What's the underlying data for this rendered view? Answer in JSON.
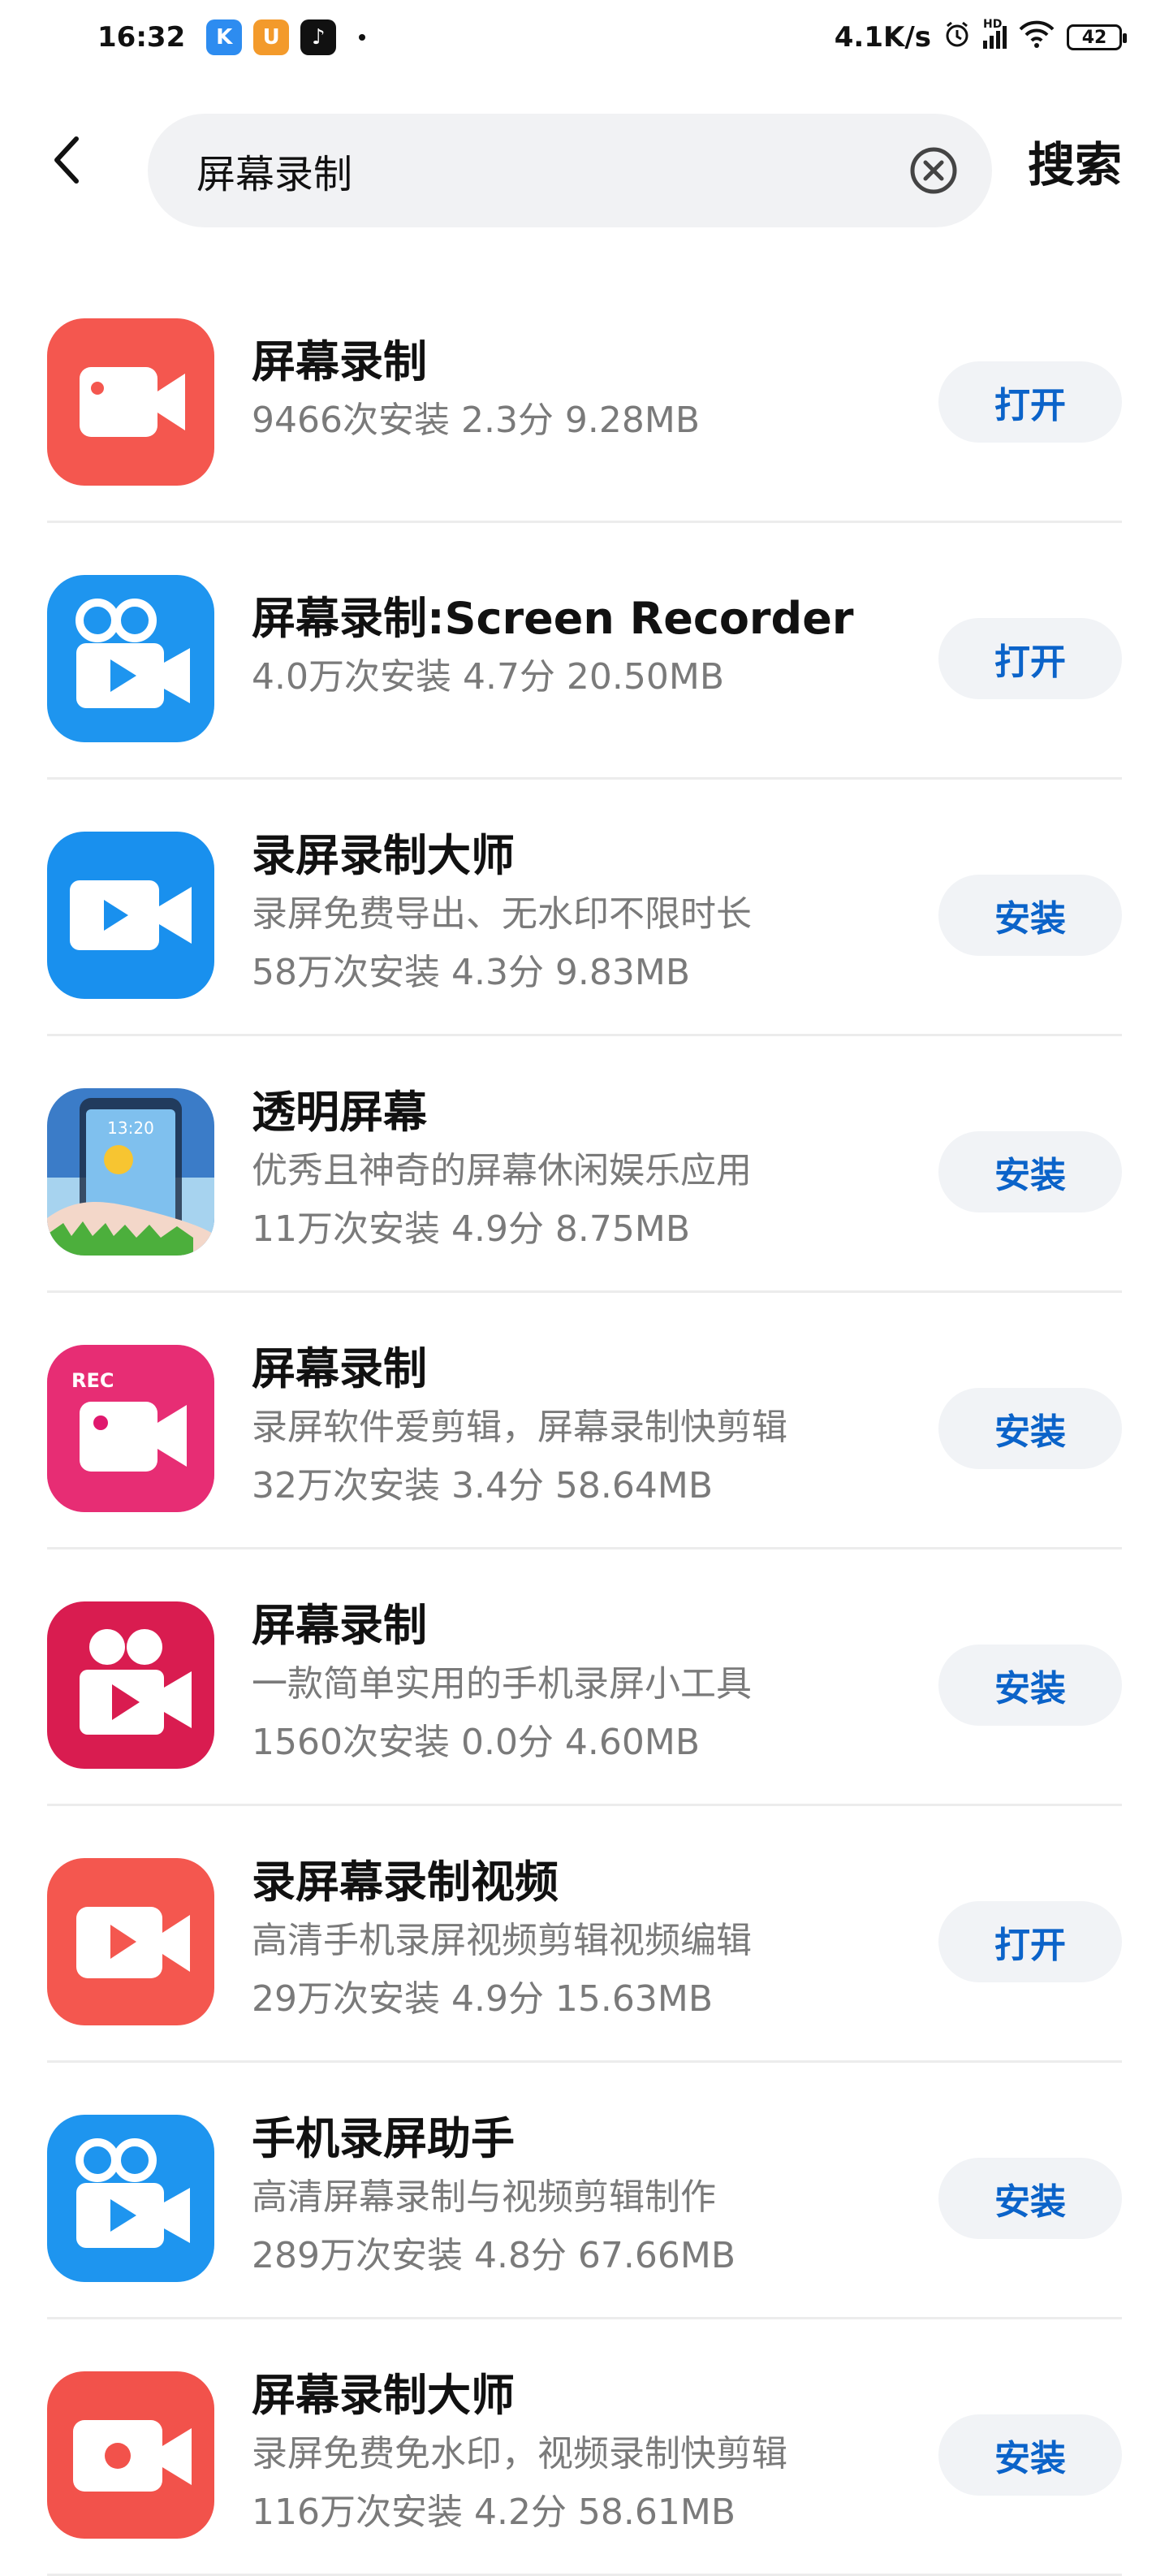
{
  "status_bar": {
    "time": "16:32",
    "net_speed": "4.1K/s",
    "battery": "42",
    "hd_label": "HD"
  },
  "search": {
    "query": "屏幕录制",
    "placeholder": "",
    "search_label": "搜索"
  },
  "apps": [
    {
      "name": "屏幕录制",
      "desc": "",
      "meta": "9466次安装 2.3分 9.28MB",
      "action": "打开",
      "icon": "video-camera-icon",
      "color": "#f4574f",
      "color2": "#ff6b61"
    },
    {
      "name": "屏幕录制:Screen Recorder",
      "desc": "",
      "meta": "4.0万次安装 4.7分 20.50MB",
      "action": "打开",
      "icon": "movie-camera-icon",
      "color": "#1e95ef",
      "color2": "#2aa3f5"
    },
    {
      "name": "录屏录制大师",
      "desc": "录屏免费导出、无水印不限时长",
      "meta": "58万次安装 4.3分 9.83MB",
      "action": "安装",
      "icon": "video-camera-play-icon",
      "color": "#1990ee",
      "color2": "#2aa5f7"
    },
    {
      "name": "透明屏幕",
      "desc": "优秀且神奇的屏幕休闲娱乐应用",
      "meta": "11万次安装 4.9分 8.75MB",
      "action": "安装",
      "icon": "transparent-screen-icon",
      "color": "#2f6fbf",
      "color2": "#7fc2f0",
      "clock": "13:20"
    },
    {
      "name": "屏幕录制",
      "desc": "录屏软件爱剪辑，屏幕录制快剪辑",
      "meta": "32万次安装 3.4分 58.64MB",
      "action": "安装",
      "icon": "rec-camera-icon",
      "color": "#e0186e",
      "color2": "#f24d7d",
      "rec": "REC"
    },
    {
      "name": "屏幕录制",
      "desc": "一款简单实用的手机录屏小工具",
      "meta": "1560次安装 0.0分 4.60MB",
      "action": "安装",
      "icon": "film-camera-icon",
      "color": "#d91c50",
      "color2": "#ef5579"
    },
    {
      "name": "录屏幕录制视频",
      "desc": "高清手机录屏视频剪辑视频编辑",
      "meta": "29万次安装 4.9分 15.63MB",
      "action": "打开",
      "icon": "play-camera-icon",
      "color": "#f4574f",
      "color2": "#ff6b61"
    },
    {
      "name": "手机录屏助手",
      "desc": "高清屏幕录制与视频剪辑制作",
      "meta": "289万次安装 4.8分 67.66MB",
      "action": "安装",
      "icon": "movie-camera-icon",
      "color": "#1e95ef",
      "color2": "#2aa3f5"
    },
    {
      "name": "屏幕录制大师",
      "desc": "录屏免费免水印，视频录制快剪辑",
      "meta": "116万次安装 4.2分 58.61MB",
      "action": "安装",
      "icon": "record-camera-icon",
      "color": "#f2524b",
      "color2": "#ff6a60"
    }
  ]
}
